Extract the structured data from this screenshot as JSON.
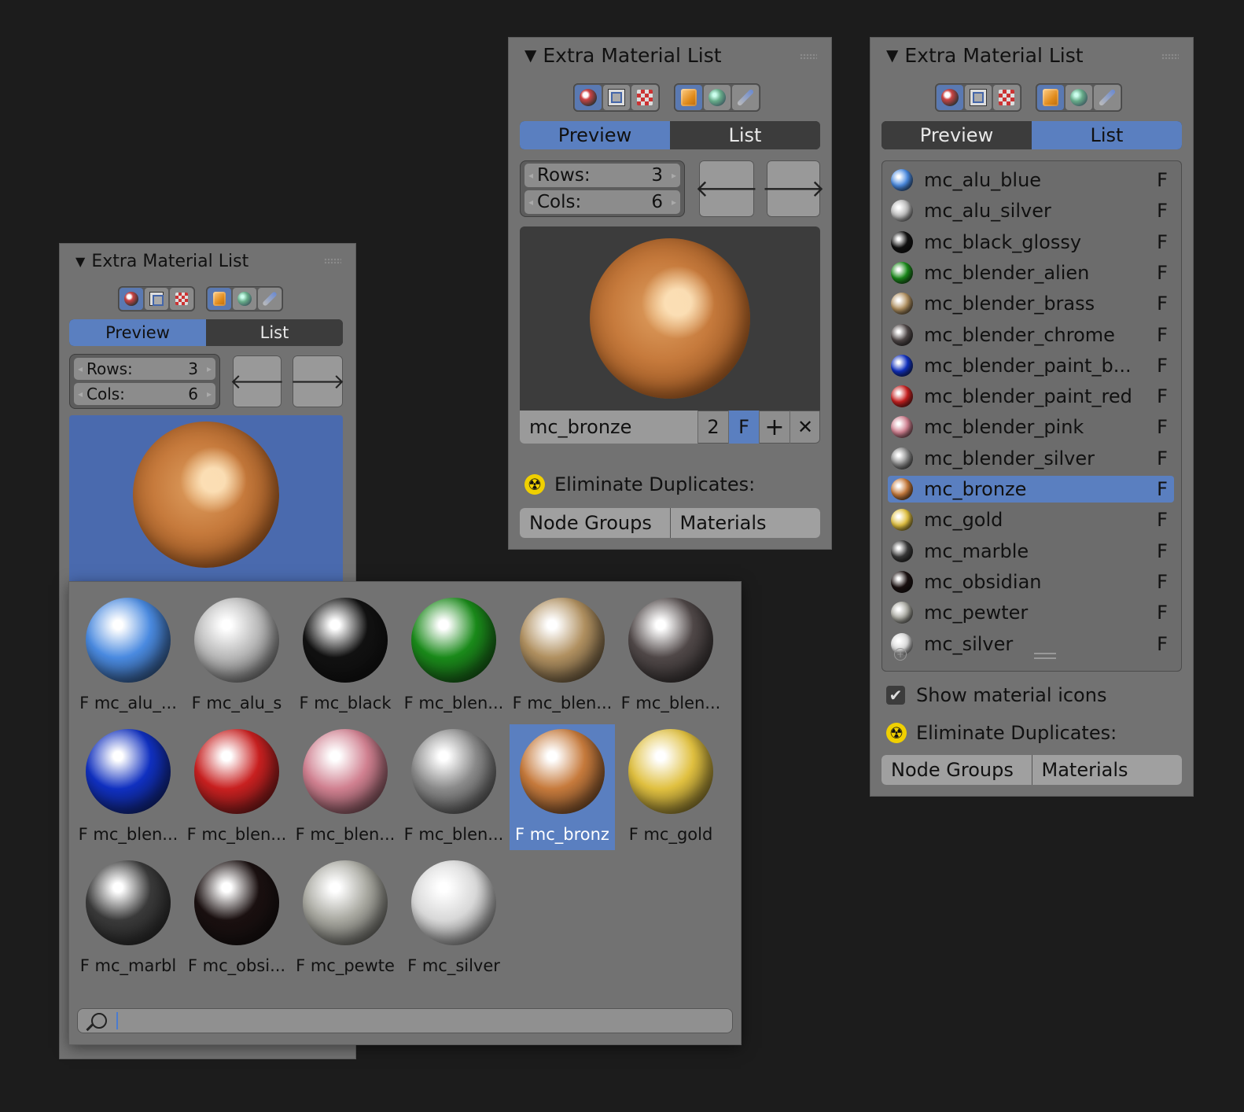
{
  "colors": {
    "background": "#1c1c1c",
    "panel": "#727272",
    "accent": "#5a7fc0",
    "dark_tab": "#3c3c3c",
    "warning_icon": "#f0d000"
  },
  "panel_title": "Extra Material List",
  "tabs": {
    "preview": "Preview",
    "list": "List"
  },
  "rows_label": "Rows:",
  "rows_value": "3",
  "cols_label": "Cols:",
  "cols_value": "6",
  "icons": {
    "header_toggle": "disclosure-triangle-icon",
    "mode_group_1": [
      "material-ball-icon",
      "image-icon",
      "texture-checker-icon"
    ],
    "mode_group_2": [
      "object-cube-icon",
      "world-icon",
      "brush-icon"
    ],
    "prev": "arrow-left-icon",
    "next": "arrow-right-icon",
    "add": "plus-icon",
    "remove": "x-icon",
    "duplicate": "radioactive-icon",
    "search": "magnifier-icon"
  },
  "glyphs": {
    "triangle": "▼",
    "left": "🡐",
    "right": "🡒",
    "plus": "+",
    "times": "✕",
    "check": "✔",
    "radioactive": "☢",
    "arrow_l": "◂",
    "arrow_r": "▸"
  },
  "middle_panel": {
    "material_name": "mc_bronze",
    "user_count": "2",
    "fake_user": "F",
    "eliminate_label": "Eliminate Duplicates:",
    "node_groups": "Node Groups",
    "materials": "Materials"
  },
  "right_panel": {
    "materials": [
      {
        "name": "mc_alu_blue",
        "flag": "F",
        "color": "#4a8ae0"
      },
      {
        "name": "mc_alu_silver",
        "flag": "F",
        "color": "#b8b8b8"
      },
      {
        "name": "mc_black_glossy",
        "flag": "F",
        "color": "#111111"
      },
      {
        "name": "mc_blender_alien",
        "flag": "F",
        "color": "#1a8a1a"
      },
      {
        "name": "mc_blender_brass",
        "flag": "F",
        "color": "#b09060"
      },
      {
        "name": "mc_blender_chrome",
        "flag": "F",
        "color": "#504848"
      },
      {
        "name": "mc_blender_paint_b...",
        "flag": "F",
        "color": "#1030c0"
      },
      {
        "name": "mc_blender_paint_red",
        "flag": "F",
        "color": "#c82020"
      },
      {
        "name": "mc_blender_pink",
        "flag": "F",
        "color": "#d08090"
      },
      {
        "name": "mc_blender_silver",
        "flag": "F",
        "color": "#8a8a8a"
      },
      {
        "name": "mc_bronze",
        "flag": "F",
        "color": "#c67a3c"
      },
      {
        "name": "mc_gold",
        "flag": "F",
        "color": "#e0c040"
      },
      {
        "name": "mc_marble",
        "flag": "F",
        "color": "#3a3a3a"
      },
      {
        "name": "mc_obsidian",
        "flag": "F",
        "color": "#1a1010"
      },
      {
        "name": "mc_pewter",
        "flag": "F",
        "color": "#a8a8a0"
      },
      {
        "name": "mc_silver",
        "flag": "F",
        "color": "#d8d8d8"
      }
    ],
    "selected_index": 10,
    "show_icons_label": "Show material icons",
    "eliminate_label": "Eliminate Duplicates:",
    "node_groups": "Node Groups",
    "materials_btn": "Materials"
  },
  "popup": {
    "thumbs": [
      {
        "label": "F mc_alu_...",
        "color": "#4a8ae0"
      },
      {
        "label": "F mc_alu_s",
        "color": "#b8b8b8"
      },
      {
        "label": "F mc_black",
        "color": "#111111"
      },
      {
        "label": "F mc_blen...",
        "color": "#1a8a1a"
      },
      {
        "label": "F mc_blen...",
        "color": "#b09060"
      },
      {
        "label": "F mc_blen...",
        "color": "#504848"
      },
      {
        "label": "F mc_blen...",
        "color": "#1030c0"
      },
      {
        "label": "F mc_blen...",
        "color": "#c82020"
      },
      {
        "label": "F mc_blen...",
        "color": "#d08090"
      },
      {
        "label": "F mc_blen...",
        "color": "#8a8a8a"
      },
      {
        "label": "F mc_bronz",
        "color": "#c67a3c"
      },
      {
        "label": "F mc_gold",
        "color": "#e0c040"
      },
      {
        "label": "F mc_marbl",
        "color": "#3a3a3a"
      },
      {
        "label": "F mc_obsi...",
        "color": "#1a1010"
      },
      {
        "label": "F mc_pewte",
        "color": "#a8a8a0"
      },
      {
        "label": "F mc_silver",
        "color": "#d8d8d8"
      }
    ],
    "selected_index": 10,
    "search_value": ""
  }
}
